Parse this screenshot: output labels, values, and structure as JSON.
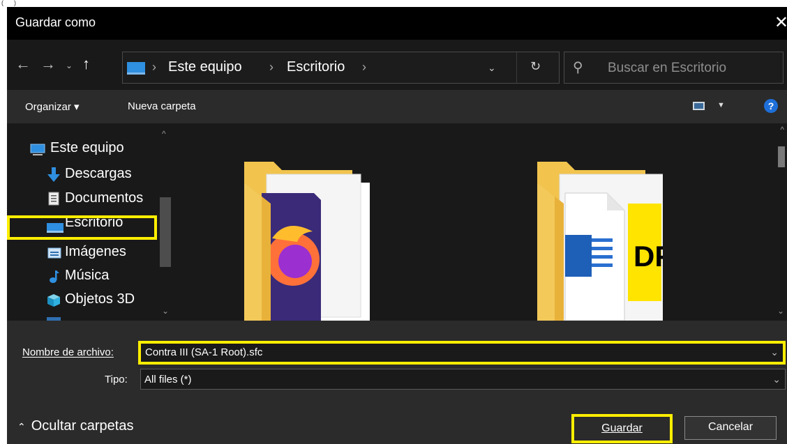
{
  "window": {
    "title": "Guardar como"
  },
  "address": {
    "crumbs": [
      "Este equipo",
      "Escritorio"
    ],
    "refresh_icon": "refresh-icon",
    "dropdown_icon": "chevron-down-icon"
  },
  "search": {
    "placeholder": "Buscar en Escritorio"
  },
  "toolbar": {
    "organize": "Organizar ▾",
    "new_folder": "Nueva carpeta",
    "help": "?"
  },
  "sidebar": {
    "items": [
      {
        "label": "Este equipo",
        "icon": "computer-icon"
      },
      {
        "label": "Descargas",
        "icon": "download-arrow-icon"
      },
      {
        "label": "Documentos",
        "icon": "document-icon"
      },
      {
        "label": "Escritorio",
        "icon": "desktop-icon",
        "selected": true
      },
      {
        "label": "Imágenes",
        "icon": "pictures-icon"
      },
      {
        "label": "Música",
        "icon": "music-note-icon"
      },
      {
        "label": "Objetos 3D",
        "icon": "cube-icon"
      }
    ]
  },
  "content": {
    "folders": [
      {
        "icon": "folder-firefox-icon"
      },
      {
        "icon": "folder-word-pdf-icon"
      }
    ]
  },
  "form": {
    "filename_label": "Nombre de archivo:",
    "filename_value": "Contra III (SA-1 Root).sfc",
    "type_label": "Tipo:",
    "type_value": "All files (*)"
  },
  "footer": {
    "hide_folders": "Ocultar carpetas",
    "save": "Guardar",
    "cancel": "Cancelar"
  },
  "colors": {
    "highlight": "#ffee00",
    "accent": "#1e6fd9",
    "background": "#191919"
  }
}
